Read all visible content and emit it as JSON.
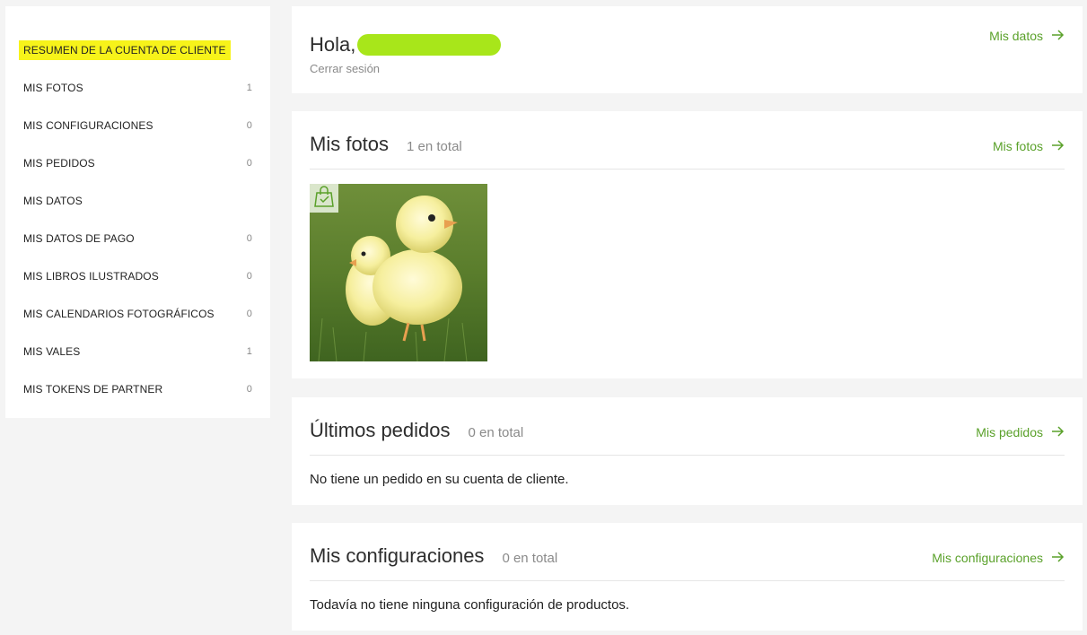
{
  "sidebar": {
    "items": [
      {
        "label": "RESUMEN DE LA CUENTA DE CLIENTE",
        "count": ""
      },
      {
        "label": "MIS FOTOS",
        "count": "1"
      },
      {
        "label": "MIS CONFIGURACIONES",
        "count": "0"
      },
      {
        "label": "MIS PEDIDOS",
        "count": "0"
      },
      {
        "label": "MIS DATOS",
        "count": ""
      },
      {
        "label": "MIS DATOS DE PAGO",
        "count": "0"
      },
      {
        "label": "MIS LIBROS ILUSTRADOS",
        "count": "0"
      },
      {
        "label": "MIS CALENDARIOS FOTOGRÁFICOS",
        "count": "0"
      },
      {
        "label": "MIS VALES",
        "count": "1"
      },
      {
        "label": "MIS TOKENS DE PARTNER",
        "count": "0"
      }
    ]
  },
  "greeting": {
    "hello": "Hola,",
    "logout": "Cerrar sesión",
    "link": "Mis datos"
  },
  "photos": {
    "title": "Mis fotos",
    "total": "1 en total",
    "link": "Mis fotos",
    "badge_icon": "shopping-bag-check-icon"
  },
  "orders": {
    "title": "Últimos pedidos",
    "total": "0 en total",
    "link": "Mis pedidos",
    "empty": "No tiene un pedido en su cuenta de cliente."
  },
  "configs": {
    "title": "Mis configuraciones",
    "total": "0 en total",
    "link": "Mis configuraciones",
    "empty": "Todavía no tiene ninguna configuración de productos."
  },
  "colors": {
    "accent": "#5aa12a",
    "highlight": "#f7f31a"
  }
}
